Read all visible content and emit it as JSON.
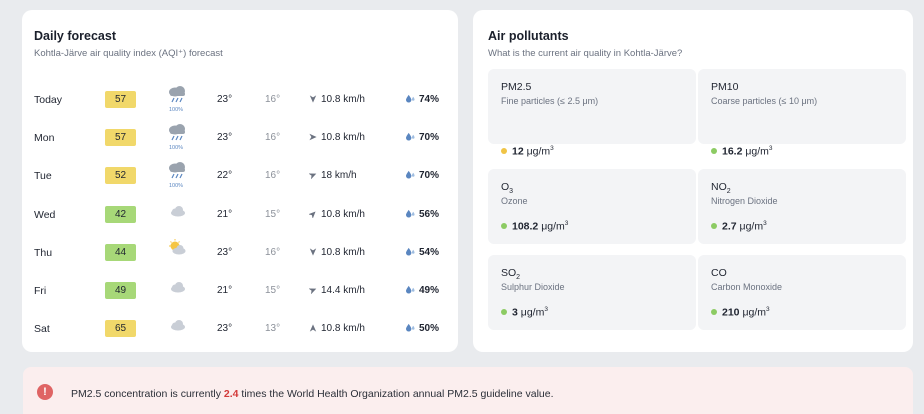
{
  "forecast": {
    "title": "Daily forecast",
    "subtitle": "Kohtla-Järve air quality index (AQI⁺) forecast",
    "rows": [
      {
        "day": "Today",
        "aqi": "57",
        "aqi_level": "yellow",
        "weather": "rain-cloud-icon",
        "precip": "100%",
        "tmax": "23°",
        "tmin": "16°",
        "wind_dir": "south",
        "wind": "10.8 km/h",
        "humidity": "74%"
      },
      {
        "day": "Mon",
        "aqi": "57",
        "aqi_level": "yellow",
        "weather": "rain-cloud-icon",
        "precip": "100%",
        "tmax": "23°",
        "tmin": "16°",
        "wind_dir": "east",
        "wind": "10.8 km/h",
        "humidity": "70%"
      },
      {
        "day": "Tue",
        "aqi": "52",
        "aqi_level": "yellow",
        "weather": "rain-cloud-icon",
        "precip": "100%",
        "tmax": "22°",
        "tmin": "16°",
        "wind_dir": "east-north-east",
        "wind": "18 km/h",
        "humidity": "70%"
      },
      {
        "day": "Wed",
        "aqi": "42",
        "aqi_level": "green",
        "weather": "cloud-icon",
        "precip": "",
        "tmax": "21°",
        "tmin": "15°",
        "wind_dir": "north-east",
        "wind": "10.8 km/h",
        "humidity": "56%"
      },
      {
        "day": "Thu",
        "aqi": "44",
        "aqi_level": "green",
        "weather": "sun-cloud-icon",
        "precip": "",
        "tmax": "23°",
        "tmin": "16°",
        "wind_dir": "south",
        "wind": "10.8 km/h",
        "humidity": "54%"
      },
      {
        "day": "Fri",
        "aqi": "49",
        "aqi_level": "green",
        "weather": "cloud-icon",
        "precip": "",
        "tmax": "21°",
        "tmin": "15°",
        "wind_dir": "east-north-east",
        "wind": "14.4 km/h",
        "humidity": "49%"
      },
      {
        "day": "Sat",
        "aqi": "65",
        "aqi_level": "yellow",
        "weather": "cloud-icon",
        "precip": "",
        "tmax": "23°",
        "tmin": "13°",
        "wind_dir": "north",
        "wind": "10.8 km/h",
        "humidity": "50%"
      }
    ]
  },
  "pollutants": {
    "title": "Air pollutants",
    "subtitle": "What is the current air quality in Kohtla-Järve?",
    "unit": "μg/m",
    "unit_exp": "3",
    "items": [
      {
        "name": "PM2.5",
        "name_sub": "",
        "desc": "Fine particles (≤ 2.5 μm)",
        "value": "12",
        "status_color": "#f0c445"
      },
      {
        "name": "PM10",
        "name_sub": "",
        "desc": "Coarse particles (≤ 10 μm)",
        "value": "16.2",
        "status_color": "#8ccb63"
      },
      {
        "name": "O",
        "name_sub": "3",
        "desc": "Ozone",
        "value": "108.2",
        "status_color": "#8ccb63"
      },
      {
        "name": "NO",
        "name_sub": "2",
        "desc": "Nitrogen Dioxide",
        "value": "2.7",
        "status_color": "#8ccb63"
      },
      {
        "name": "SO",
        "name_sub": "2",
        "desc": "Sulphur Dioxide",
        "value": "3",
        "status_color": "#8ccb63"
      },
      {
        "name": "CO",
        "name_sub": "",
        "desc": "Carbon Monoxide",
        "value": "210",
        "status_color": "#8ccb63"
      }
    ]
  },
  "alert": {
    "icon": "exclamation-icon",
    "text_before": "PM2.5 concentration is currently ",
    "highlight": "2.4",
    "text_after": " times the World Health Organization annual PM2.5 guideline value."
  },
  "colors": {
    "aqi_yellow": "#f1d86a",
    "aqi_green": "#a7d878",
    "alert_red": "#df6464"
  }
}
